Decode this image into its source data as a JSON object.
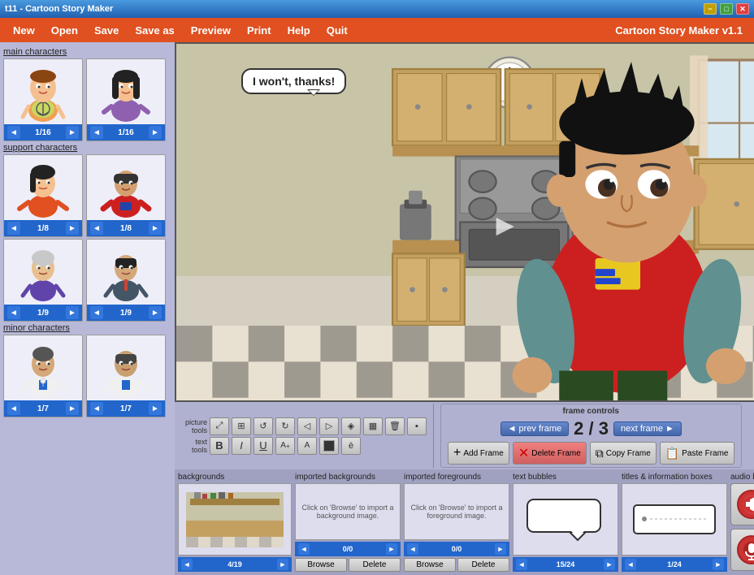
{
  "titlebar": {
    "title": "t11 - Cartoon Story Maker",
    "min_label": "−",
    "max_label": "□",
    "close_label": "✕"
  },
  "menubar": {
    "items": [
      "New",
      "Open",
      "Save",
      "Save as",
      "Preview",
      "Print",
      "Help",
      "Quit"
    ],
    "app_title": "Cartoon Story Maker v1.1"
  },
  "left_panel": {
    "main_characters_label": "main characters",
    "char1_nav": "1/16",
    "char2_nav": "1/16",
    "support_characters_label": "support characters",
    "char3_nav": "1/8",
    "char4_nav": "1/8",
    "char5_nav": "1/9",
    "char6_nav": "1/9",
    "minor_characters_label": "minor characters",
    "char7_nav": "1/7",
    "char8_nav": "1/7"
  },
  "canvas": {
    "speech_bubble_text": "I won't, thanks!"
  },
  "toolbar": {
    "picture_tools_label": "picture tools",
    "text_tools_label": "text tools",
    "picture_buttons": [
      "⤢",
      "⊞",
      "↺",
      "↻",
      "◁",
      "▷",
      "◈",
      "▦",
      "🗑",
      "▪"
    ],
    "text_buttons_row1": [
      "B",
      "I",
      "U",
      "A⁺",
      "A",
      "■",
      "è"
    ],
    "bold_label": "B",
    "italic_label": "I",
    "underline_label": "U",
    "font_up_label": "A+",
    "font_down_label": "A",
    "color_label": "■",
    "special_label": "è"
  },
  "frame_controls": {
    "label": "frame controls",
    "prev_frame_label": "◄ prev frame",
    "next_frame_label": "next frame ►",
    "current_frame": "2",
    "total_frames": "3",
    "frame_separator": "/",
    "add_frame_label": "Add Frame",
    "delete_frame_label": "Delete Frame",
    "copy_frame_label": "Copy Frame",
    "paste_frame_label": "Paste Frame"
  },
  "bottom_panel": {
    "backgrounds_label": "backgrounds",
    "bg_nav": "4/19",
    "imported_bg_label": "imported backgrounds",
    "imported_bg_text": "Click on 'Browse' to import a background image.",
    "imported_bg_nav": "0/0",
    "imported_fg_label": "imported foregrounds",
    "imported_fg_text": "Click on 'Browse' to import a foreground image.",
    "imported_fg_nav": "0/0",
    "text_bubbles_label": "text bubbles",
    "text_bubble_nav": "15/24",
    "titles_label": "titles & information boxes",
    "titles_nav": "1/24",
    "audio_label": "audio bubbles",
    "browse_label": "Browse",
    "delete_label": "Delete"
  }
}
